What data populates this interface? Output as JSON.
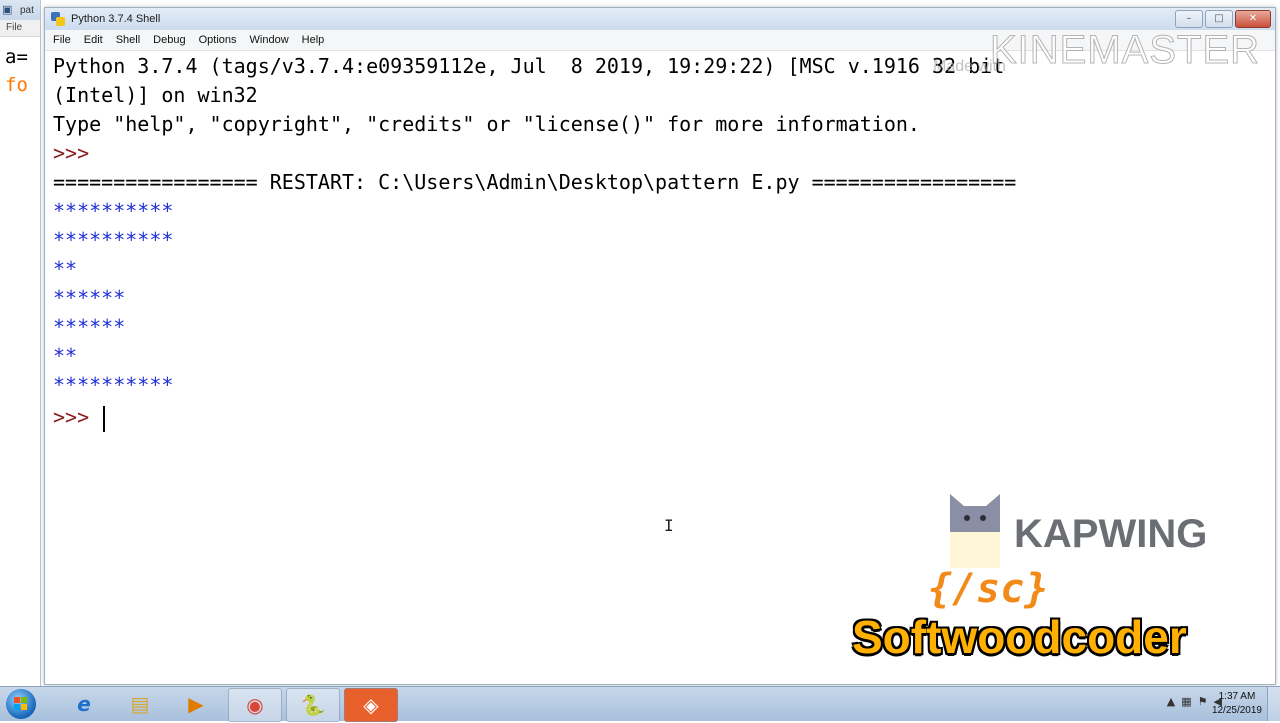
{
  "background_window": {
    "title": "pat",
    "menu": "File",
    "code_lines": [
      "a=",
      "fo"
    ]
  },
  "window": {
    "title": "Python 3.7.4 Shell",
    "controls": {
      "minimize": "–",
      "maximize": "□",
      "close": "✕"
    }
  },
  "menu": {
    "items": [
      "File",
      "Edit",
      "Shell",
      "Debug",
      "Options",
      "Window",
      "Help"
    ]
  },
  "console": {
    "banner_1": "Python 3.7.4 (tags/v3.7.4:e09359112e, Jul  8 2019, 19:29:22) [MSC v.1916 32 bit",
    "banner_2": "(Intel)] on win32",
    "banner_3": "Type \"help\", \"copyright\", \"credits\" or \"license()\" for more information.",
    "prompt": ">>>",
    "restart": "================= RESTART: C:\\Users\\Admin\\Desktop\\pattern E.py =================",
    "output": [
      "**********",
      "**********",
      "**",
      "******",
      "******",
      "**",
      "**********"
    ],
    "final_prompt": ">>> "
  },
  "watermarks": {
    "kinemaster": "KINEMASTER",
    "made_with": "Made with",
    "kapwing": "KAPWING",
    "sc_logo": "{/sc}",
    "channel": "Softwoodcoder"
  },
  "taskbar": {
    "apps": [
      {
        "icon": "internet-explorer-icon",
        "glyph": "e"
      },
      {
        "icon": "file-explorer-icon",
        "glyph": "▤"
      },
      {
        "icon": "media-player-icon",
        "glyph": "▶"
      },
      {
        "icon": "chrome-icon",
        "glyph": "◉"
      },
      {
        "icon": "python-icon",
        "glyph": "🐍"
      },
      {
        "icon": "kinemaster-icon",
        "glyph": "◈"
      }
    ],
    "clock_time": "1:37 AM",
    "clock_date": "12/25/2019"
  },
  "colors": {
    "prompt": "#8b1a1a",
    "output": "#1f2fd6",
    "keyword_orange": "#ff7700",
    "channel_text": "#ffb000"
  }
}
